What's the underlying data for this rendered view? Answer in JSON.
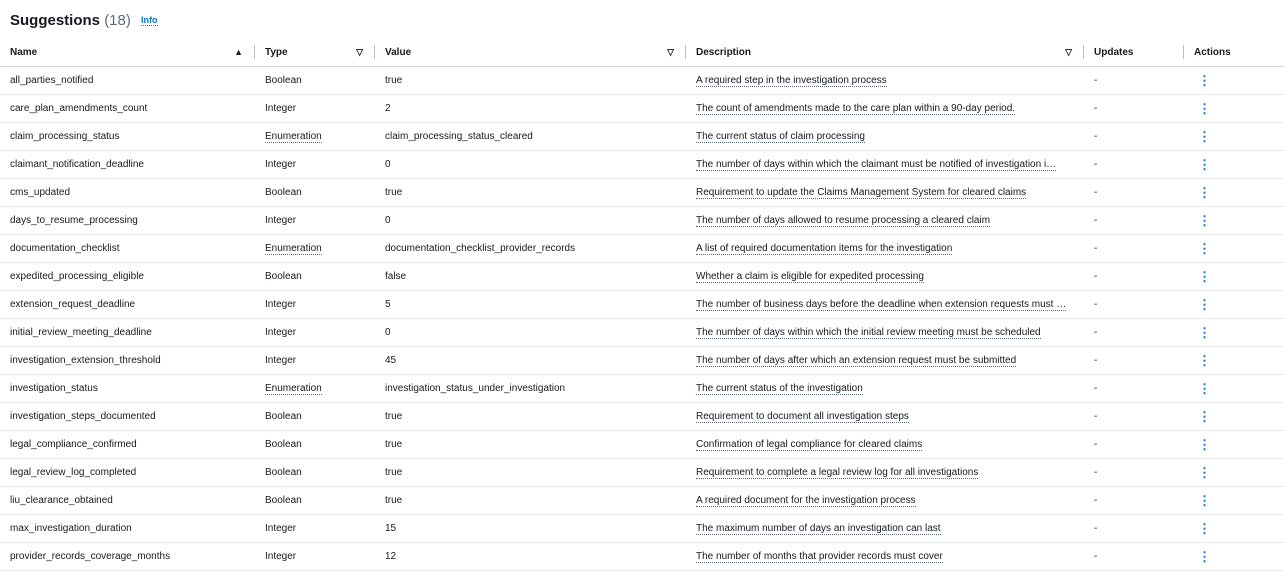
{
  "header": {
    "title": "Suggestions",
    "count": "(18)",
    "info": "Info"
  },
  "columns": [
    {
      "label": "Name",
      "sort": "▲"
    },
    {
      "label": "Type",
      "sort": "▽"
    },
    {
      "label": "Value",
      "sort": "▽"
    },
    {
      "label": "Description",
      "sort": "▽"
    },
    {
      "label": "Updates",
      "sort": ""
    },
    {
      "label": "Actions",
      "sort": ""
    }
  ],
  "actions_icon": "⋮",
  "rows": [
    {
      "name": "all_parties_notified",
      "type": "Boolean",
      "value": "true",
      "description": "A required step in the investigation process",
      "updates": "-"
    },
    {
      "name": "care_plan_amendments_count",
      "type": "Integer",
      "value": "2",
      "description": "The count of amendments made to the care plan within a 90-day period.",
      "updates": "-"
    },
    {
      "name": "claim_processing_status",
      "type": "Enumeration",
      "value": "claim_processing_status_cleared",
      "description": "The current status of claim processing",
      "updates": "-"
    },
    {
      "name": "claimant_notification_deadline",
      "type": "Integer",
      "value": "0",
      "description": "The number of days within which the claimant must be notified of investigation i…",
      "updates": "-"
    },
    {
      "name": "cms_updated",
      "type": "Boolean",
      "value": "true",
      "description": "Requirement to update the Claims Management System for cleared claims",
      "updates": "-"
    },
    {
      "name": "days_to_resume_processing",
      "type": "Integer",
      "value": "0",
      "description": "The number of days allowed to resume processing a cleared claim",
      "updates": "-"
    },
    {
      "name": "documentation_checklist",
      "type": "Enumeration",
      "value": "documentation_checklist_provider_records",
      "description": "A list of required documentation items for the investigation",
      "updates": "-"
    },
    {
      "name": "expedited_processing_eligible",
      "type": "Boolean",
      "value": "false",
      "description": "Whether a claim is eligible for expedited processing",
      "updates": "-"
    },
    {
      "name": "extension_request_deadline",
      "type": "Integer",
      "value": "5",
      "description": "The number of business days before the deadline when extension requests must …",
      "updates": "-"
    },
    {
      "name": "initial_review_meeting_deadline",
      "type": "Integer",
      "value": "0",
      "description": "The number of days within which the initial review meeting must be scheduled",
      "updates": "-"
    },
    {
      "name": "investigation_extension_threshold",
      "type": "Integer",
      "value": "45",
      "description": "The number of days after which an extension request must be submitted",
      "updates": "-"
    },
    {
      "name": "investigation_status",
      "type": "Enumeration",
      "value": "investigation_status_under_investigation",
      "description": "The current status of the investigation",
      "updates": "-"
    },
    {
      "name": "investigation_steps_documented",
      "type": "Boolean",
      "value": "true",
      "description": "Requirement to document all investigation steps",
      "updates": "-"
    },
    {
      "name": "legal_compliance_confirmed",
      "type": "Boolean",
      "value": "true",
      "description": "Confirmation of legal compliance for cleared claims",
      "updates": "-"
    },
    {
      "name": "legal_review_log_completed",
      "type": "Boolean",
      "value": "true",
      "description": "Requirement to complete a legal review log for all investigations",
      "updates": "-"
    },
    {
      "name": "liu_clearance_obtained",
      "type": "Boolean",
      "value": "true",
      "description": "A required document for the investigation process",
      "updates": "-"
    },
    {
      "name": "max_investigation_duration",
      "type": "Integer",
      "value": "15",
      "description": "The maximum number of days an investigation can last",
      "updates": "-"
    },
    {
      "name": "provider_records_coverage_months",
      "type": "Integer",
      "value": "12",
      "description": "The number of months that provider records must cover",
      "updates": "-"
    }
  ]
}
